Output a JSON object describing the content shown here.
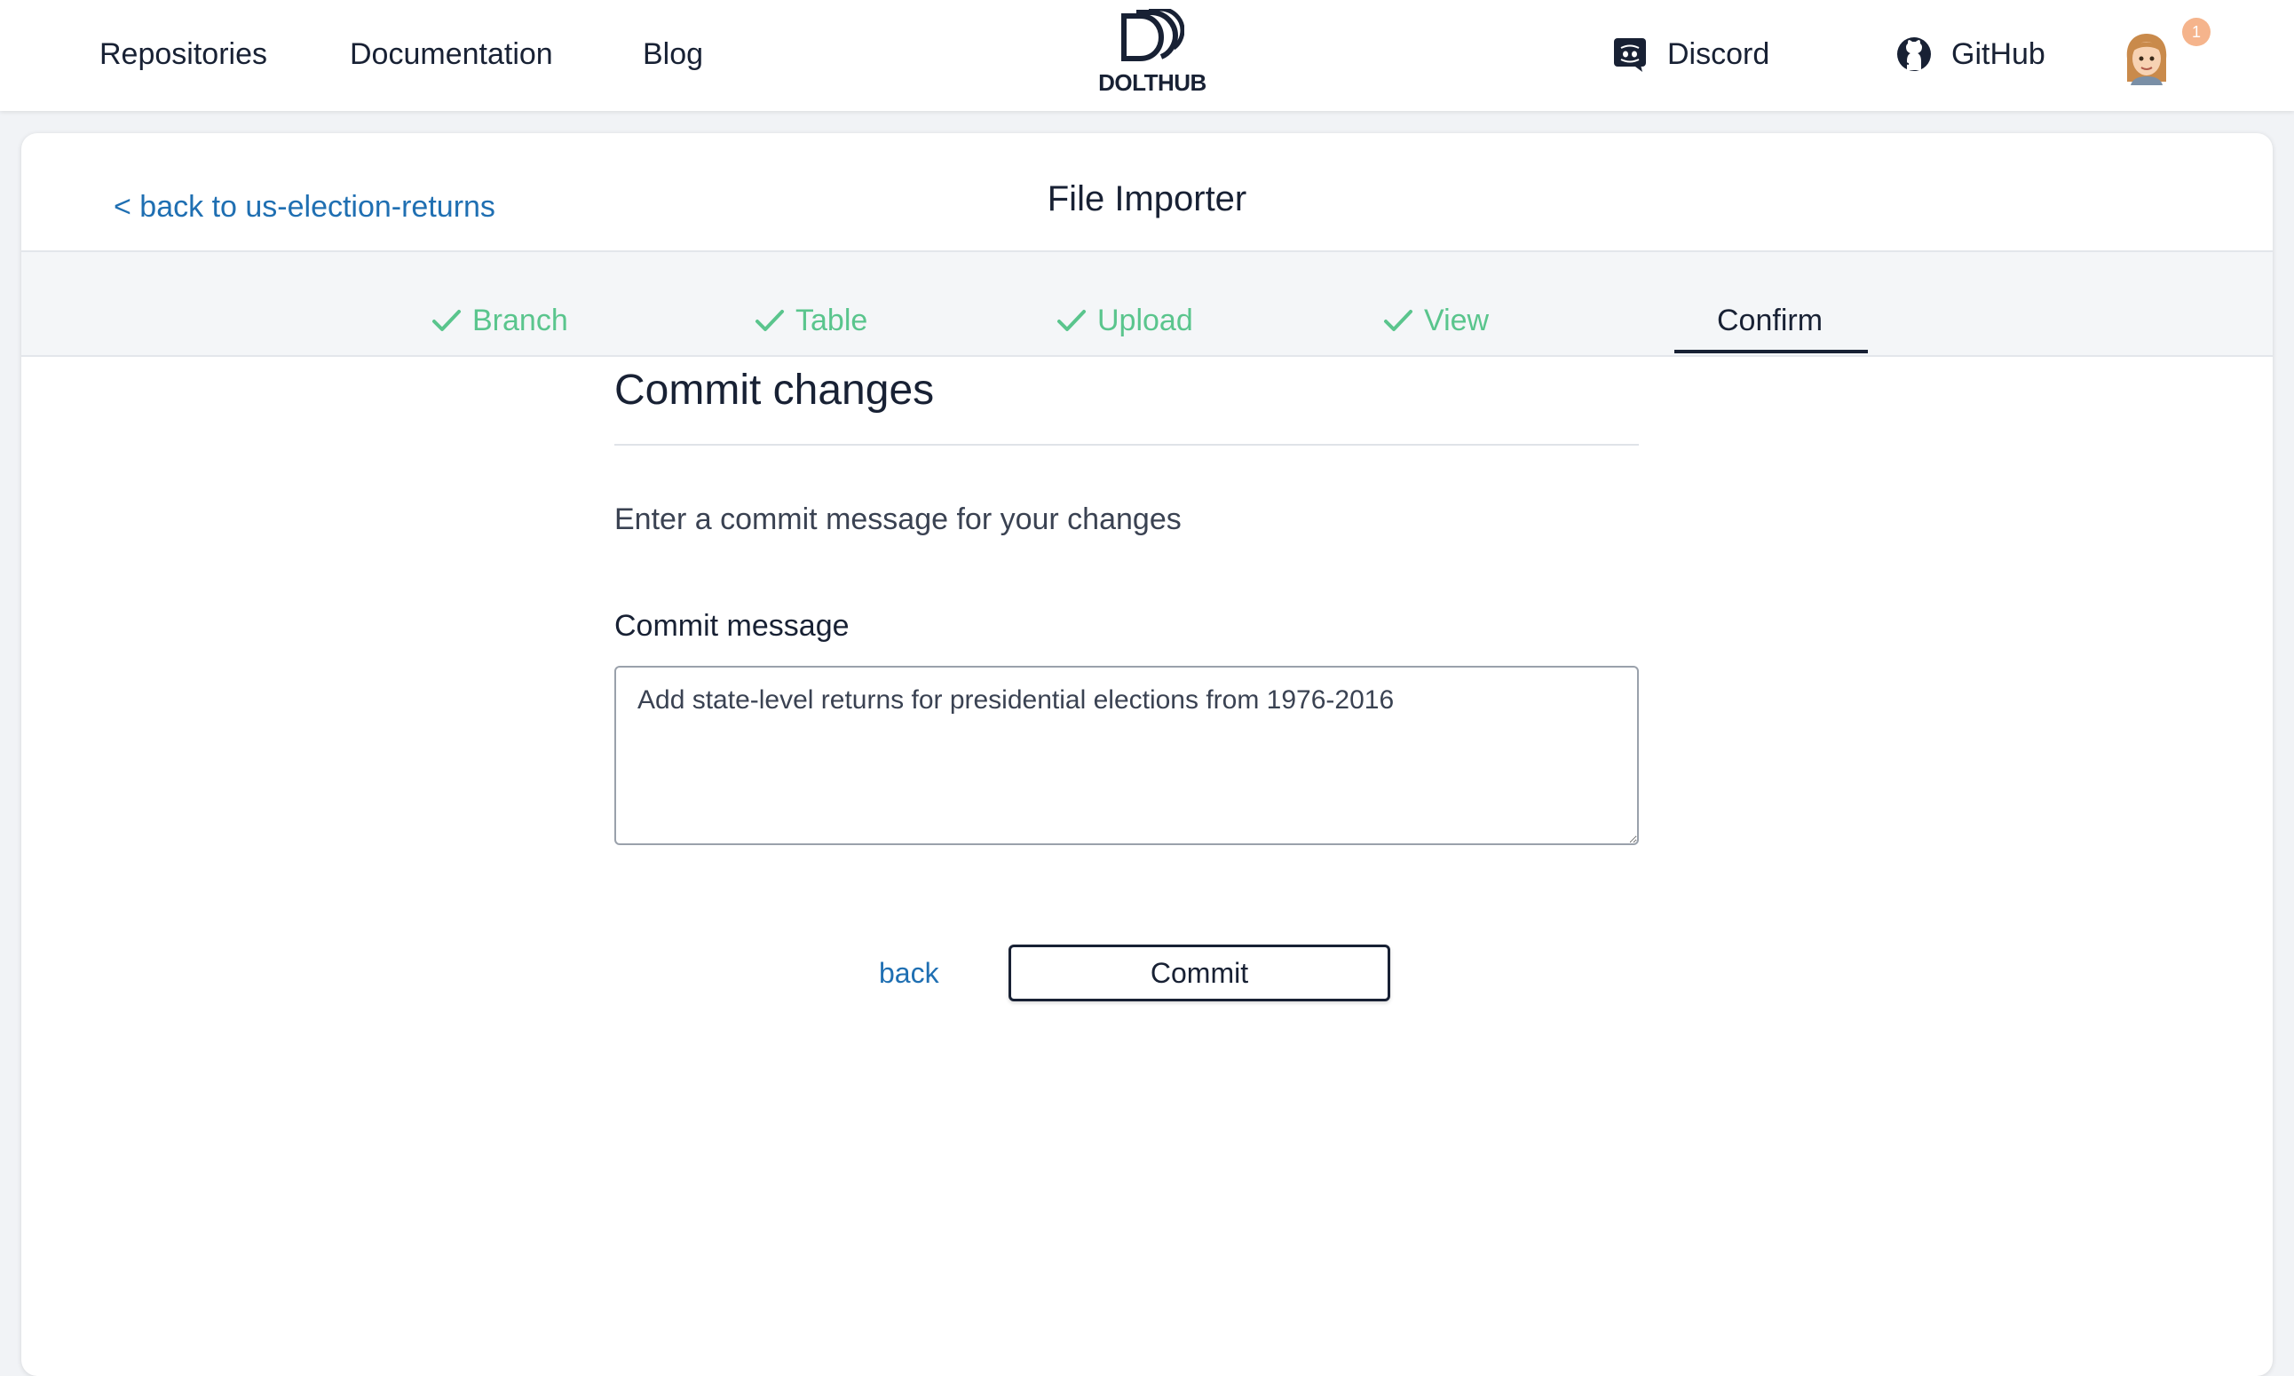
{
  "nav": {
    "left_links": [
      "Repositories",
      "Documentation",
      "Blog"
    ],
    "logo_text": "DOLTHUB",
    "discord_label": "Discord",
    "github_label": "GitHub",
    "notification_count": "1"
  },
  "header": {
    "back_link": "< back to us-election-returns",
    "title": "File Importer"
  },
  "steps": [
    {
      "label": "Branch",
      "status": "done"
    },
    {
      "label": "Table",
      "status": "done"
    },
    {
      "label": "Upload",
      "status": "done"
    },
    {
      "label": "View",
      "status": "done"
    },
    {
      "label": "Confirm",
      "status": "active"
    }
  ],
  "form": {
    "title": "Commit changes",
    "description": "Enter a commit message for your changes",
    "field_label": "Commit message",
    "commit_message": "Add state-level returns for presidential elections from 1976-2016",
    "back_label": "back",
    "commit_label": "Commit"
  },
  "colors": {
    "navy": "#182134",
    "link_blue": "#1f6fb2",
    "step_done_green": "#5ac58d",
    "badge_orange": "#f5b48c"
  }
}
